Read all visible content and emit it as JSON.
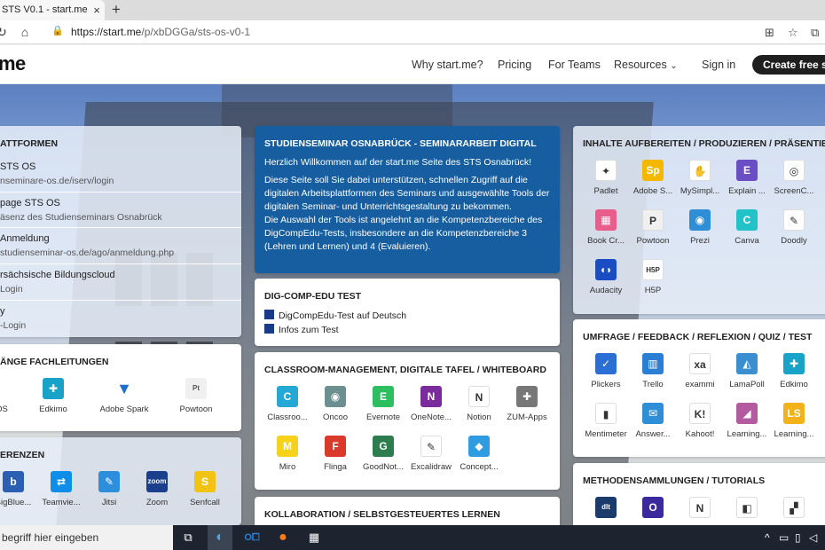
{
  "browser": {
    "tab_title": "STS V0.1 - start.me",
    "tab_close": "×",
    "new_tab": "+",
    "url_host": "https://start.me",
    "url_path": "/p/xbDGGa/sts-os-v0-1"
  },
  "site": {
    "logo": "me",
    "nav": [
      "Why start.me?",
      "Pricing",
      "For Teams",
      "Resources"
    ],
    "signin": "Sign in",
    "cta": "Create free st"
  },
  "widgets": {
    "plattformen": {
      "title": "ATTFORMEN",
      "items": [
        {
          "title": "STS OS",
          "sub": "nseminare-os.de/iserv/login"
        },
        {
          "title": "page STS OS",
          "sub": "äsenz des Studienseminars Osnabrück"
        },
        {
          "title": "Anmeldung",
          "sub": "studienseminar-os.de/ago/anmeldung.php"
        },
        {
          "title": "rsächsische Bildungscloud",
          "sub": "Login"
        },
        {
          "title": "y",
          "sub": "-Login"
        }
      ]
    },
    "fachleitungen": {
      "title": "ÄNGE FACHLEITUNGEN",
      "apps": [
        {
          "label": "OS",
          "icon": "app-icon",
          "color": "#ffffff"
        },
        {
          "label": "Edkimo",
          "icon": "edkimo-icon",
          "color": "#19a3c9"
        },
        {
          "label": "Adobe Spark",
          "icon": "adobe-spark-icon",
          "color": "#1f6fd1"
        },
        {
          "label": "Powtoon",
          "icon": "powtoon-icon",
          "color": "#f0f0f0"
        }
      ]
    },
    "konferenzen": {
      "title": "ERENZEN",
      "apps": [
        {
          "label": "BigBlue...",
          "icon": "bigbluebutton-icon",
          "glyph": "b",
          "color": "#2b5fb4"
        },
        {
          "label": "Teamvie...",
          "icon": "teamviewer-icon",
          "glyph": "⇄",
          "color": "#0e8ee9"
        },
        {
          "label": "Jitsi",
          "icon": "jitsi-icon",
          "glyph": "✎",
          "color": "#2d8fdc"
        },
        {
          "label": "Zoom",
          "icon": "zoom-icon",
          "glyph": "zoom",
          "color": "#1a3f8c"
        },
        {
          "label": "Senfcall",
          "icon": "senfcall-icon",
          "glyph": "S",
          "color": "#f2c313"
        }
      ]
    },
    "seminararbeit": {
      "title": "STUDIENSEMINAR OSNABRÜCK - SEMINARARBEIT DIGITAL",
      "paragraphs": [
        "Herzlich Willkommen auf der start.me Seite des STS Osnabrück!",
        "Diese Seite soll Sie dabei unterstützen, schnellen Zugriff auf die digitalen Arbeitsplattformen des Seminars und ausgewählte Tools der digitalen Seminar- und Unterrichtsgestaltung zu bekommen.",
        "Die Auswahl der Tools ist angelehnt an die Kompetenzbereiche des DigCompEdu-Tests, insbesondere an die Kompetenzbereiche 3 (Lehren und Lernen) und 4 (Evaluieren)."
      ]
    },
    "digcomp": {
      "title": "DIG-COMP-EDU TEST",
      "links": [
        "DigCompEdu-Test auf Deutsch",
        "Infos zum Test"
      ]
    },
    "classroom": {
      "title": "CLASSROOM-MANAGEMENT, DIGITALE TAFEL / WHITEBOARD",
      "apps": [
        {
          "label": "Classroo...",
          "icon": "classroomscreen-icon",
          "glyph": "C",
          "color": "#24a9d6"
        },
        {
          "label": "Oncoo",
          "icon": "oncoo-icon",
          "glyph": "◉",
          "color": "#6c8f8f"
        },
        {
          "label": "Evernote",
          "icon": "evernote-icon",
          "glyph": "E",
          "color": "#2dbe60"
        },
        {
          "label": "OneNote...",
          "icon": "onenote-icon",
          "glyph": "N",
          "color": "#7b2c9c"
        },
        {
          "label": "Notion",
          "icon": "notion-icon",
          "glyph": "N",
          "color": "#ffffff"
        },
        {
          "label": "ZUM-Apps",
          "icon": "puzzle-icon",
          "glyph": "✚",
          "color": "#777777"
        },
        {
          "label": "Miro",
          "icon": "miro-icon",
          "glyph": "M",
          "color": "#f7d21a"
        },
        {
          "label": "Flinga",
          "icon": "flinga-icon",
          "glyph": "F",
          "color": "#d93a2b"
        },
        {
          "label": "GoodNot...",
          "icon": "goodnotes-icon",
          "glyph": "G",
          "color": "#2e7d4f"
        },
        {
          "label": "Excalidraw",
          "icon": "excalidraw-icon",
          "glyph": "✎",
          "color": "#ffffff"
        },
        {
          "label": "Concept...",
          "icon": "conceptboard-icon",
          "glyph": "◆",
          "color": "#2f9be0"
        }
      ]
    },
    "kollaboration": {
      "title": "KOLLABORATION / SELBSTGESTEUERTES LERNEN"
    },
    "inhalte": {
      "title": "INHALTE AUFBEREITEN / PRODUZIEREN / PRÄSENTIEREN",
      "apps": [
        {
          "label": "Padlet",
          "icon": "padlet-icon",
          "glyph": "✦",
          "color": "#ffffff"
        },
        {
          "label": "Adobe S...",
          "icon": "adobe-spark-icon",
          "glyph": "Sp",
          "color": "#f5b800"
        },
        {
          "label": "MySimpl...",
          "icon": "mysimpleshow-icon",
          "glyph": "✋",
          "color": "#ffffff"
        },
        {
          "label": "Explain ...",
          "icon": "explain-everything-icon",
          "glyph": "E",
          "color": "#6a4fc4"
        },
        {
          "label": "ScreenC...",
          "icon": "screencast-icon",
          "glyph": "◎",
          "color": "#ffffff"
        },
        {
          "label": "Book Cr...",
          "icon": "book-creator-icon",
          "glyph": "▦",
          "color": "#e85d8c"
        },
        {
          "label": "Powtoon",
          "icon": "powtoon-icon",
          "glyph": "P",
          "color": "#f0f0f0"
        },
        {
          "label": "Prezi",
          "icon": "prezi-icon",
          "glyph": "◉",
          "color": "#2f8fd6"
        },
        {
          "label": "Canva",
          "icon": "canva-icon",
          "glyph": "C",
          "color": "#21c3c8"
        },
        {
          "label": "Doodly",
          "icon": "doodly-icon",
          "glyph": "✎",
          "color": "#ffffff"
        },
        {
          "label": "Audacity",
          "icon": "audacity-icon",
          "glyph": "◖◗",
          "color": "#1a4cc4"
        },
        {
          "label": "H5P",
          "icon": "h5p-icon",
          "glyph": "H5P",
          "color": "#ffffff"
        }
      ]
    },
    "umfrage": {
      "title": "UMFRAGE / FEEDBACK / REFLEXION / QUIZ / TEST",
      "apps": [
        {
          "label": "Plickers",
          "icon": "plickers-icon",
          "glyph": "✓",
          "color": "#2b6fd6"
        },
        {
          "label": "Trello",
          "icon": "trello-icon",
          "glyph": "▥",
          "color": "#2a7fd4"
        },
        {
          "label": "exammi",
          "icon": "exammi-icon",
          "glyph": "xa",
          "color": "#ffffff"
        },
        {
          "label": "LamaPoll",
          "icon": "lamapoll-icon",
          "glyph": "◭",
          "color": "#3b8fd0"
        },
        {
          "label": "Edkimo",
          "icon": "edkimo-icon",
          "glyph": "✚",
          "color": "#19a3c9"
        },
        {
          "label": "Mentimeter",
          "icon": "mentimeter-icon",
          "glyph": "▮",
          "color": "#ffffff"
        },
        {
          "label": "Answer...",
          "icon": "answergarden-icon",
          "glyph": "✉",
          "color": "#2f8fd6"
        },
        {
          "label": "Kahoot!",
          "icon": "kahoot-icon",
          "glyph": "K!",
          "color": "#ffffff"
        },
        {
          "label": "Learning...",
          "icon": "learningapps-icon",
          "glyph": "◢",
          "color": "#b35aa0"
        },
        {
          "label": "Learning...",
          "icon": "learningsnacks-icon",
          "glyph": "LS",
          "color": "#f2b31a"
        }
      ]
    },
    "methoden": {
      "title": "METHODENSAMMLUNGEN / TUTORIALS",
      "apps": [
        {
          "label": "",
          "icon": "method-icon",
          "glyph": "dlt",
          "color": "#1c3b6d"
        },
        {
          "label": "",
          "icon": "circle-o-icon",
          "glyph": "O",
          "color": "#3a2a9c"
        },
        {
          "label": "",
          "icon": "n-icon",
          "glyph": "N",
          "color": "#ffffff"
        },
        {
          "label": "",
          "icon": "tutorial-icon",
          "glyph": "◧",
          "color": "#ffffff"
        },
        {
          "label": "",
          "icon": "colorful-icon",
          "glyph": "▞",
          "color": "#ffffff"
        }
      ]
    }
  },
  "taskbar": {
    "search_placeholder": "begriff hier eingeben"
  }
}
